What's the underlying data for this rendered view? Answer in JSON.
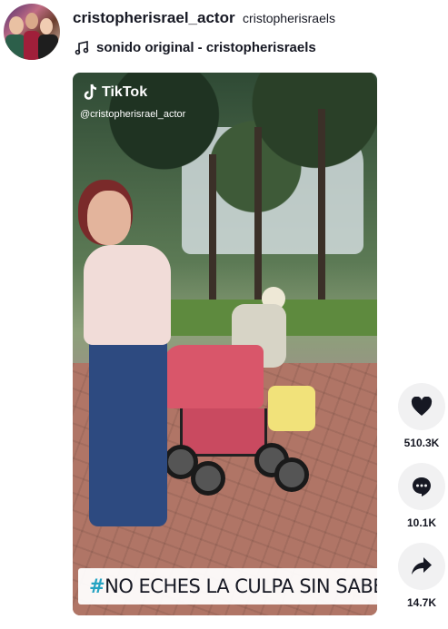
{
  "post": {
    "author_username": "cristopherisrael_actor",
    "author_handle": "cristopherisraels",
    "music": "sonido original - cristopherisraels"
  },
  "video": {
    "brand": "TikTok",
    "watermark": "@cristopherisrael_actor",
    "caption_hashtag": "#",
    "caption_text": "NO ECHES LA CULPA SIN SABER"
  },
  "actions": {
    "likes": "510.3K",
    "comments": "10.1K",
    "shares": "14.7K"
  },
  "icons": {
    "music": "music-note-icon",
    "like": "heart-icon",
    "comment": "comment-bubble-icon",
    "share": "share-arrow-icon",
    "brand": "tiktok-logo-icon"
  },
  "colors": {
    "hashtag": "#25a3c2",
    "action_bg": "#f1f1f2",
    "text": "#161823"
  }
}
